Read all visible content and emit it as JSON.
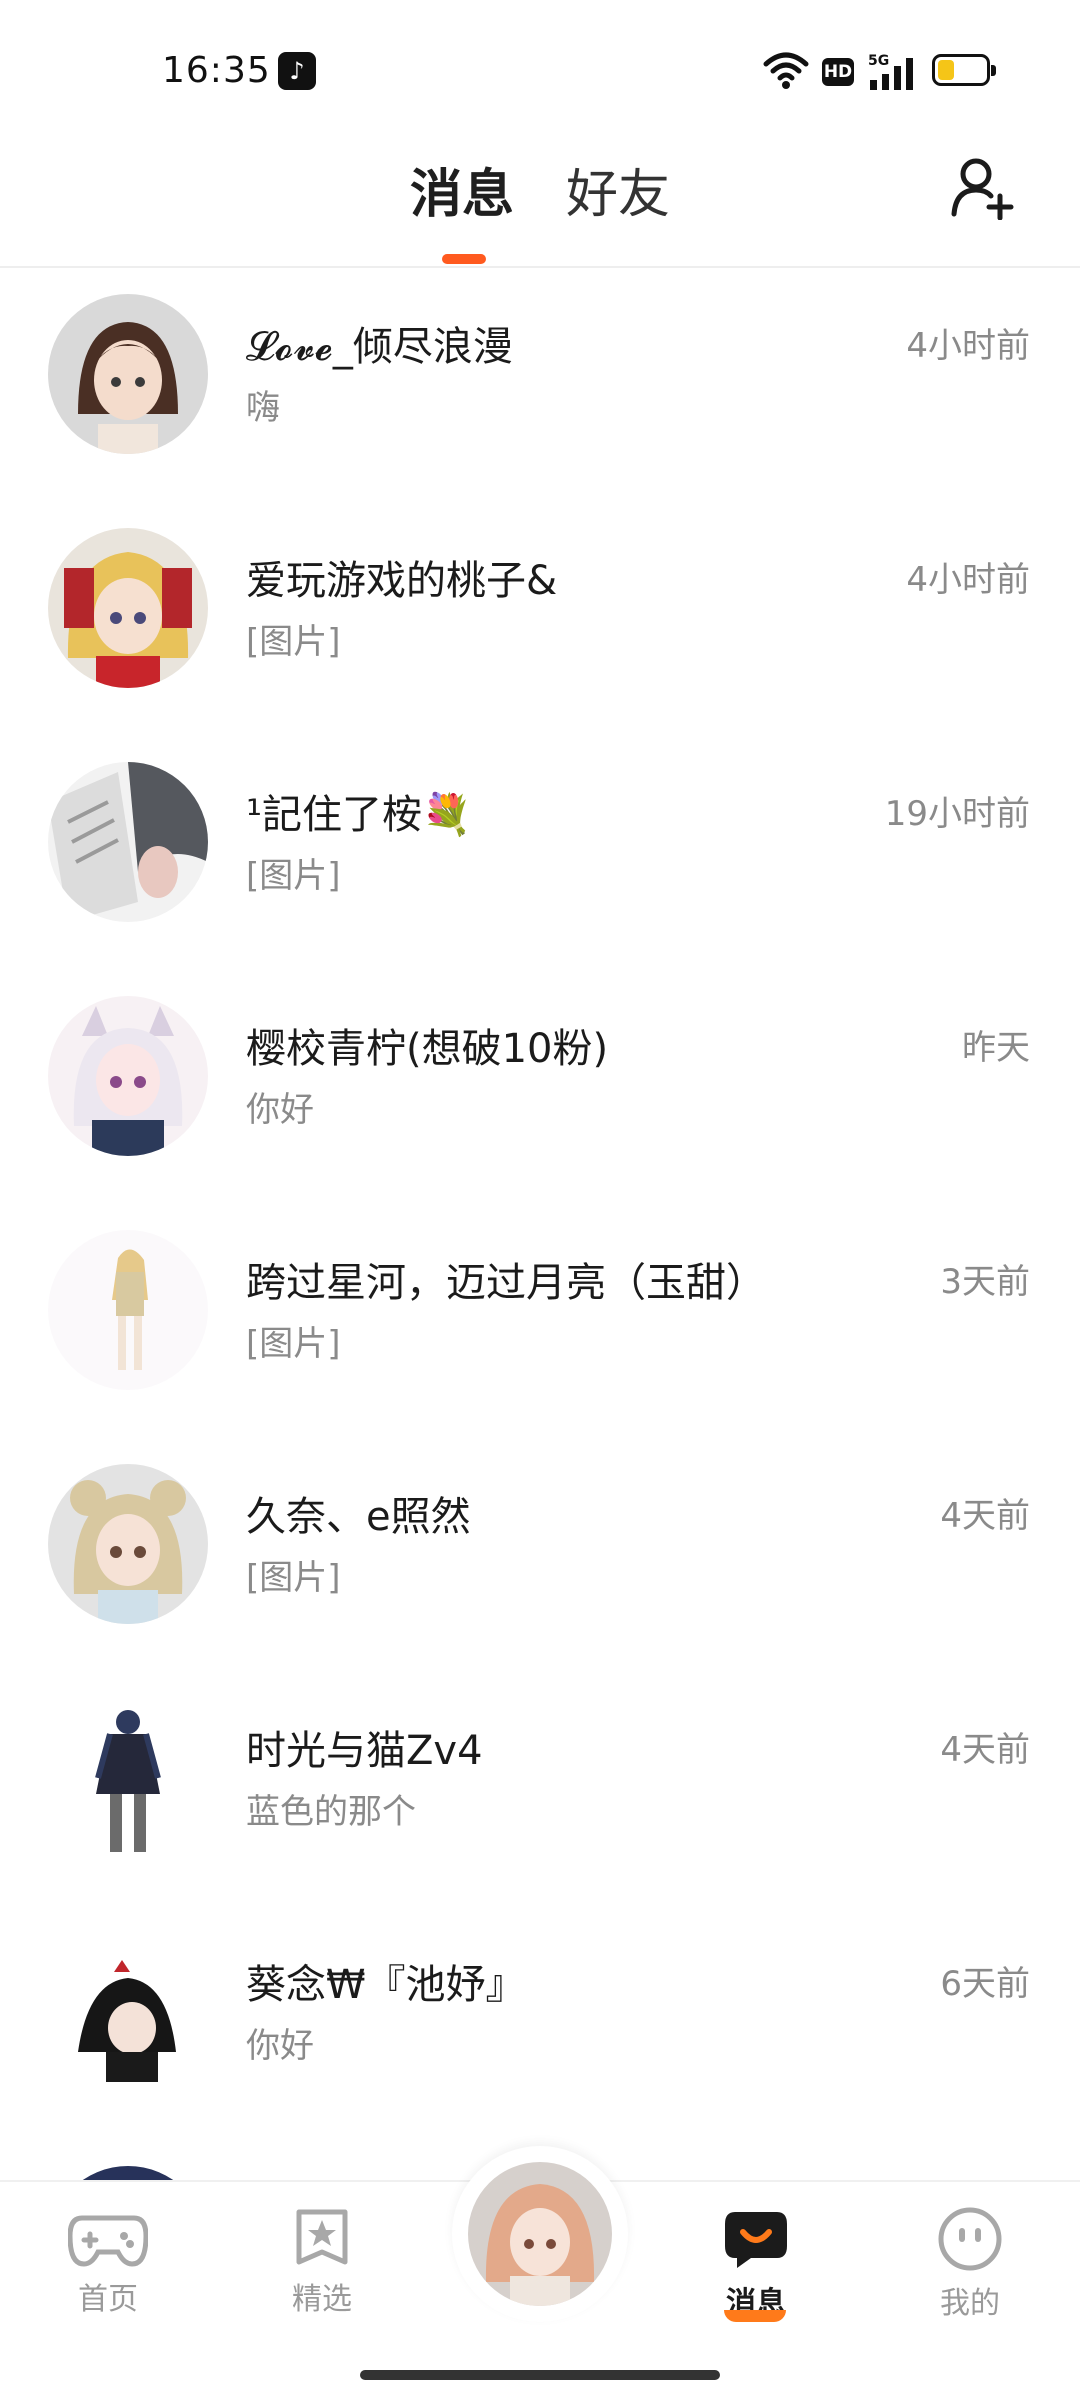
{
  "status_bar": {
    "time": "16:35",
    "battery_level": 0.35,
    "network": "5G"
  },
  "header": {
    "tabs": [
      {
        "label": "消息",
        "active": true
      },
      {
        "label": "好友",
        "active": false
      }
    ]
  },
  "conversations": [
    {
      "name": "𝓛𝓸𝓿𝓮_倾尽浪漫",
      "preview": "嗨",
      "time": "4小时前"
    },
    {
      "name": "爱玩游戏的桃子&",
      "preview": "[图片]",
      "time": "4小时前"
    },
    {
      "name": "¹記住了桉💐",
      "preview": "[图片]",
      "time": "19小时前"
    },
    {
      "name": "樱校青柠(想破10粉)",
      "preview": "你好",
      "time": "昨天"
    },
    {
      "name": "跨过星河，迈过月亮（玉甜）",
      "preview": "[图片]",
      "time": "3天前"
    },
    {
      "name": "久奈、e照然",
      "preview": "[图片]",
      "time": "4天前"
    },
    {
      "name": "时光与猫Zv4",
      "preview": "蓝色的那个",
      "time": "4天前"
    },
    {
      "name": "葵念₩『池妤』",
      "preview": "你好",
      "time": "6天前"
    }
  ],
  "bottom_nav": {
    "items": [
      {
        "label": "首页",
        "icon": "gamepad-icon"
      },
      {
        "label": "精选",
        "icon": "star-badge-icon"
      },
      {
        "label": "消息",
        "icon": "chat-bubble-icon",
        "active": true
      },
      {
        "label": "我的",
        "icon": "face-icon"
      }
    ]
  },
  "colors": {
    "accent": "#ff5a1f",
    "text_primary": "#1b1b1b",
    "text_secondary": "#8a8a8a"
  }
}
